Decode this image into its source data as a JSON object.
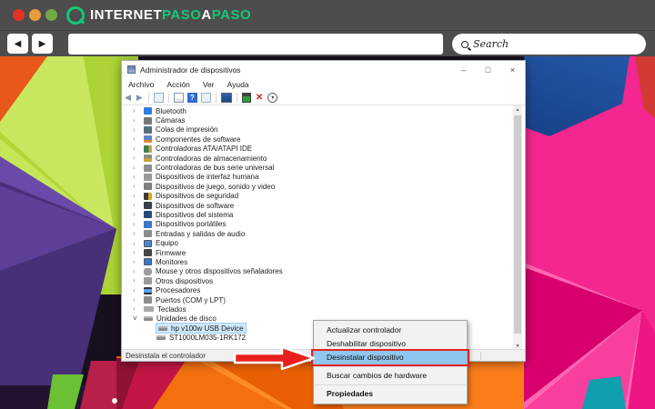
{
  "browser": {
    "traffic_lights": [
      "#e53224",
      "#e69c3c",
      "#6faa44"
    ],
    "logo": {
      "seg1": "INTERNET",
      "seg2": "PASO",
      "seg3": "A",
      "seg4": "PASO",
      "green": "#14c878"
    },
    "url_value": "",
    "search": {
      "placeholder": "Search"
    }
  },
  "icons": {
    "back": "◀",
    "forward": "▶",
    "minimize": "–",
    "maximize": "□",
    "close": "×",
    "help_glyph": "?",
    "red_x": "✕",
    "scan_glyph": "▾",
    "chevron_collapsed": "›",
    "chevron_expanded": "˅",
    "scroll_up": "▲",
    "scroll_down": "▼"
  },
  "device_manager": {
    "title": "Administrador de dispositivos",
    "menu_bar": [
      "Archivo",
      "Acción",
      "Ver",
      "Ayuda"
    ],
    "status_bar_text": "Desinstala el controlador",
    "tree": {
      "items": [
        {
          "label": "Bluetooth",
          "icon": "bluetooth",
          "level": 0,
          "state": "collapsed"
        },
        {
          "label": "Cámaras",
          "icon": "camera",
          "level": 0,
          "state": "collapsed"
        },
        {
          "label": "Colas de impresión",
          "icon": "printer",
          "level": 0,
          "state": "collapsed"
        },
        {
          "label": "Componentes de software",
          "icon": "software-component",
          "level": 0,
          "state": "collapsed"
        },
        {
          "label": "Controladoras ATA/ATAPI IDE",
          "icon": "ata-controller",
          "level": 0,
          "state": "collapsed"
        },
        {
          "label": "Controladoras de almacenamiento",
          "icon": "storage-controller",
          "level": 0,
          "state": "collapsed"
        },
        {
          "label": "Controladoras de bus serie universal",
          "icon": "usb-controller",
          "level": 0,
          "state": "collapsed"
        },
        {
          "label": "Dispositivos de interfaz humana",
          "icon": "hid",
          "level": 0,
          "state": "collapsed"
        },
        {
          "label": "Dispositivos de juego, sonido y video",
          "icon": "game-audio",
          "level": 0,
          "state": "collapsed"
        },
        {
          "label": "Dispositivos de seguridad",
          "icon": "security",
          "level": 0,
          "state": "collapsed"
        },
        {
          "label": "Dispositivos de software",
          "icon": "software-device",
          "level": 0,
          "state": "collapsed"
        },
        {
          "label": "Dispositivos del sistema",
          "icon": "system-device",
          "level": 0,
          "state": "collapsed"
        },
        {
          "label": "Dispositivos portátiles",
          "icon": "portable-device",
          "level": 0,
          "state": "collapsed"
        },
        {
          "label": "Entradas y salidas de audio",
          "icon": "audio-io",
          "level": 0,
          "state": "collapsed"
        },
        {
          "label": "Equipo",
          "icon": "computer",
          "level": 0,
          "state": "collapsed"
        },
        {
          "label": "Firmware",
          "icon": "firmware",
          "level": 0,
          "state": "collapsed"
        },
        {
          "label": "Monitores",
          "icon": "monitor",
          "level": 0,
          "state": "collapsed"
        },
        {
          "label": "Mouse y otros dispositivos señaladores",
          "icon": "mouse",
          "level": 0,
          "state": "collapsed"
        },
        {
          "label": "Otros dispositivos",
          "icon": "other-device",
          "level": 0,
          "state": "collapsed"
        },
        {
          "label": "Procesadores",
          "icon": "processor",
          "level": 0,
          "state": "collapsed"
        },
        {
          "label": "Puertos (COM y LPT)",
          "icon": "ports",
          "level": 0,
          "state": "collapsed"
        },
        {
          "label": "Teclados",
          "icon": "keyboard",
          "level": 0,
          "state": "collapsed"
        },
        {
          "label": "Unidades de disco",
          "icon": "disk",
          "level": 0,
          "state": "expanded"
        },
        {
          "label": "hp v100w USB Device",
          "icon": "disk",
          "level": 1,
          "selected": true
        },
        {
          "label": "ST1000LM035-1RK172",
          "icon": "disk",
          "level": 1
        }
      ]
    }
  },
  "context_menu": {
    "items": [
      {
        "label": "Actualizar controlador"
      },
      {
        "label": "Deshabilitar dispositivo"
      },
      {
        "label": "Desinstalar dispositivo",
        "highlighted": true
      },
      {
        "label": "Buscar cambios de hardware",
        "separator_before": true
      },
      {
        "label": "Propiedades",
        "bold": true,
        "separator_before": true
      }
    ]
  },
  "annotation": {
    "color": "#e8201d"
  }
}
